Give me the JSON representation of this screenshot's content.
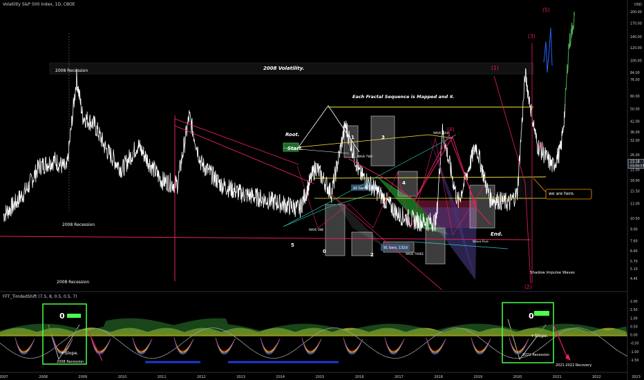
{
  "header": {
    "symbol_line": "Volatility S&P 500 Index, 1D, CBOE",
    "indicator_line": "FFT_TimdedShift (7.5, 8, 0.5, 0.5, 7)",
    "currency": "USD"
  },
  "price_axis": {
    "ticks": [
      "200.00",
      "170.00",
      "140.00",
      "120.00",
      "100.00",
      "84.00",
      "76.00",
      "60.00",
      "50.00",
      "42.00",
      "36.00",
      "32.00",
      "26.00",
      "23.18",
      "21.00",
      "18.00",
      "15.50",
      "13.00",
      "10.50",
      "9.00",
      "7.60",
      "6.60",
      "5.70",
      "5.10",
      "4.45"
    ],
    "last_price": "23.18",
    "countdown": "03:09:57"
  },
  "indicator_axis": {
    "ticks": [
      "2.00",
      "1.50",
      "1.00",
      "0.50",
      "0.00",
      "-0.50",
      "-1.00",
      "-1.50"
    ]
  },
  "time_axis": {
    "ticks": [
      "2007",
      "2008",
      "2009",
      "2010",
      "2011",
      "2012",
      "2013",
      "2014",
      "2015",
      "2016",
      "2017",
      "2018",
      "2019",
      "2020",
      "2021",
      "2022",
      "2023"
    ]
  },
  "annotations": {
    "recession_top": "2008 Recession",
    "recession_mid": "2008 Recession",
    "recession_low": "2008 Recession",
    "volatility_banner": "2008 Volatility.",
    "fractal_note": "Each Fractal Sequence is Mapped and #.",
    "root": "Root.",
    "start": "Start.",
    "end": "End.",
    "we_are_here": "we are here.",
    "shadow": "Shadow Impulse Waves",
    "wave_one": "WAVE ONE",
    "wave_two": "WAVE TWO",
    "wave_three": "WAVE THREE",
    "wave_four": "WAVE FOUR",
    "wave_five": "Wave Five",
    "bars_a": "91 bars, 132d",
    "bars_b": "91 bars, 132d",
    "n1": "1",
    "n2": "2",
    "n3": "3",
    "n4": "4",
    "n0": "0",
    "n5": "5",
    "w1": "(1)",
    "w2": "(2)",
    "w3": "(3)",
    "w4a": "(4)",
    "w4b": "(4)",
    "w5": "(5)",
    "osc_zero_left": "0",
    "osc_zero_right": "0",
    "slope_left": "+Slope.",
    "slope_right": "+Slope.",
    "osc_rec_left": "2008 Recession",
    "osc_rec_right": "2021 Recession",
    "recovery": "2021-2022 Recovery."
  },
  "chart_data": {
    "type": "line",
    "title": "Volatility S&P 500 Index, 1D, CBOE",
    "log_scale": true,
    "grid": false,
    "series": [
      {
        "name": "VIX",
        "x": [
          2007.0,
          2007.3,
          2007.6,
          2007.9,
          2008.3,
          2008.6,
          2008.85,
          2009.0,
          2009.3,
          2009.6,
          2010.0,
          2010.4,
          2010.7,
          2011.0,
          2011.4,
          2011.7,
          2012.0,
          2012.5,
          2013.0,
          2013.5,
          2014.0,
          2014.5,
          2014.9,
          2015.3,
          2015.65,
          2016.0,
          2016.5,
          2017.0,
          2017.5,
          2017.95,
          2018.1,
          2018.5,
          2018.95,
          2019.3,
          2019.8,
          2020.0,
          2020.2,
          2020.5,
          2020.9,
          2021.1,
          2021.2,
          2021.3,
          2021.45
        ],
        "y": [
          11,
          13,
          16,
          22,
          24,
          21,
          78,
          45,
          40,
          28,
          21,
          30,
          23,
          18,
          17,
          45,
          23,
          17,
          15,
          14,
          13,
          12,
          22,
          15,
          40,
          20,
          15,
          11,
          10,
          10,
          37,
          13,
          30,
          14,
          13,
          15,
          82,
          30,
          22,
          28,
          48,
          120,
          190
        ]
      }
    ],
    "ylim": [
      4.45,
      200
    ]
  }
}
